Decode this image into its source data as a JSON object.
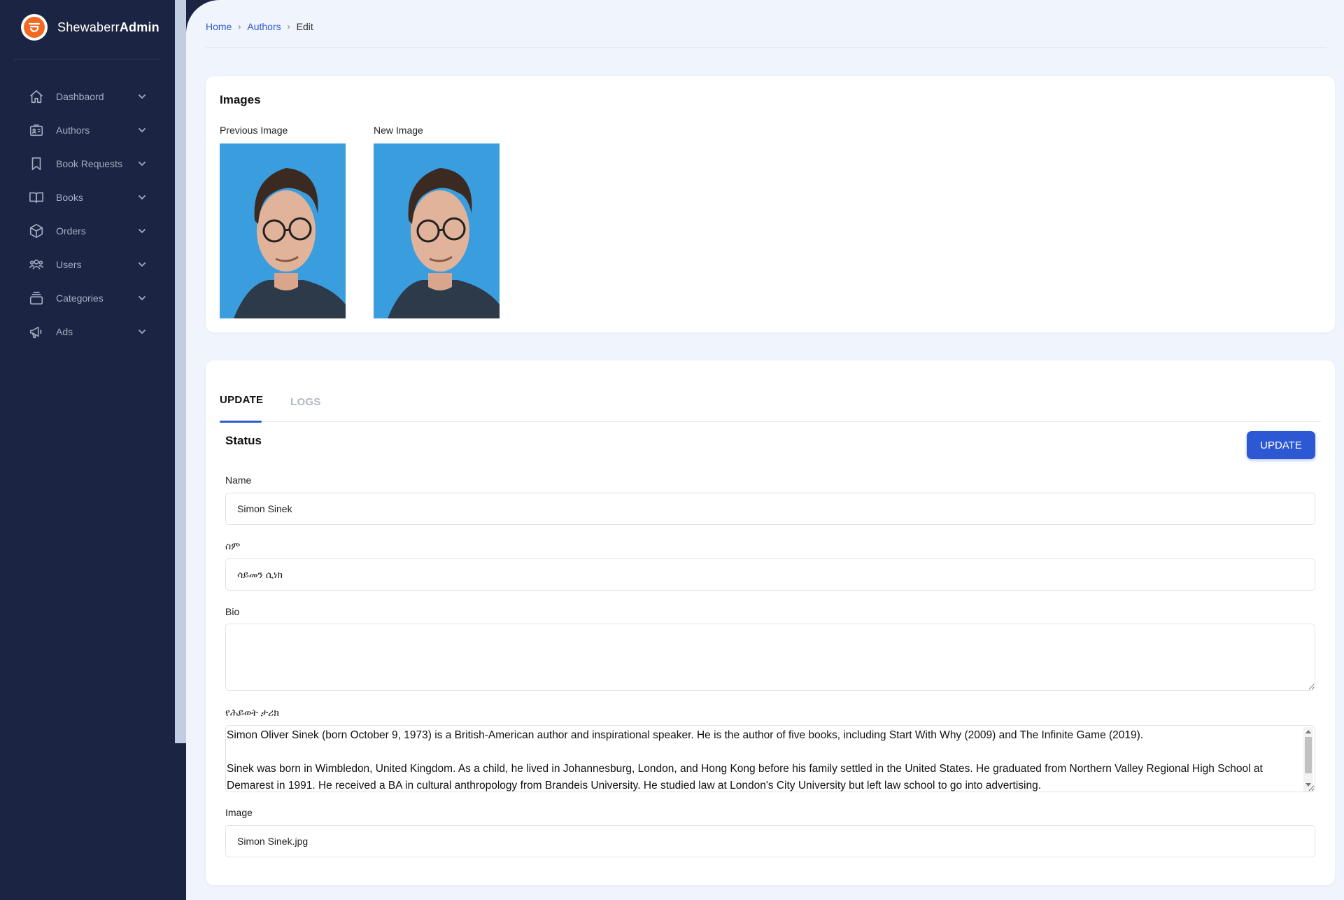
{
  "brand": {
    "name_light": "Shewaberr",
    "name_bold": "Admin"
  },
  "sidebar": {
    "items": [
      {
        "label": "Dashbaord",
        "icon": "home-icon"
      },
      {
        "label": "Authors",
        "icon": "id-card-icon"
      },
      {
        "label": "Book Requests",
        "icon": "bookmark-icon"
      },
      {
        "label": "Books",
        "icon": "book-open-icon"
      },
      {
        "label": "Orders",
        "icon": "cube-icon"
      },
      {
        "label": "Users",
        "icon": "users-icon"
      },
      {
        "label": "Categories",
        "icon": "archive-icon"
      },
      {
        "label": "Ads",
        "icon": "megaphone-icon"
      }
    ]
  },
  "breadcrumb": {
    "home": "Home",
    "authors": "Authors",
    "current": "Edit"
  },
  "images_card": {
    "title": "Images",
    "previous_label": "Previous Image",
    "new_label": "New Image"
  },
  "form": {
    "tabs": {
      "update": "UPDATE",
      "logs": "LOGS"
    },
    "status_title": "Status",
    "update_button": "UPDATE",
    "name_label": "Name",
    "name_value": "Simon Sinek",
    "name_am_label": "ስም",
    "name_am_value": "ሳይመን ሲነክ",
    "bio_label": "Bio",
    "bio_value": "",
    "bio_am_label": "የሕይወት ታሪክ",
    "bio_am_value": "Simon Oliver Sinek (born October 9, 1973) is a British-American author and inspirational speaker. He is the author of five books, including Start With Why (2009) and The Infinite Game (2019).\n\nSinek was born in Wimbledon, United Kingdom. As a child, he lived in Johannesburg, London, and Hong Kong before his family settled in the United States. He graduated from Northern Valley Regional High School at Demarest in 1991. He received a BA in cultural anthropology from Brandeis University. He studied law at London's City University but left law school to go into advertising.",
    "image_label": "Image",
    "image_value": "Simon Sinek.jpg"
  },
  "colors": {
    "sidebar": "#1b2543",
    "accent": "#2c58d3",
    "brand_orange": "#f26a21",
    "background": "#eff4fd"
  }
}
